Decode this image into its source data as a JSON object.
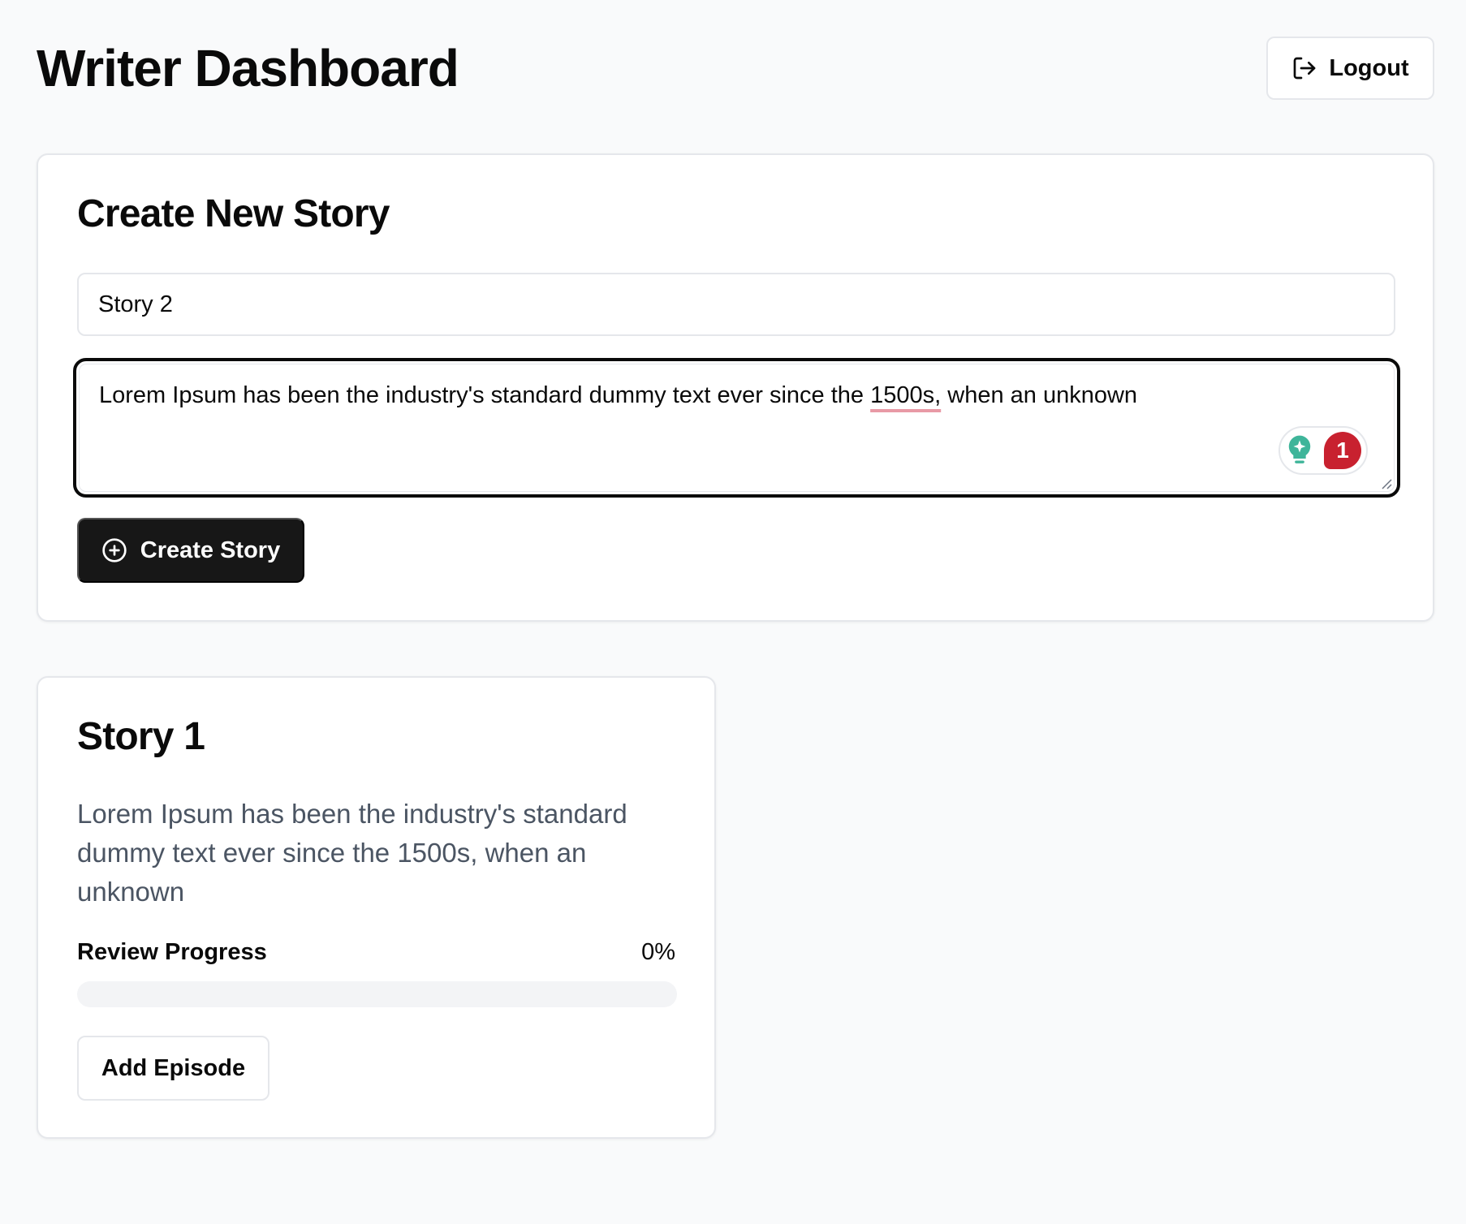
{
  "header": {
    "title": "Writer Dashboard",
    "logout_label": "Logout",
    "logout_icon": "log-out-icon"
  },
  "create_story": {
    "heading": "Create New Story",
    "title_value": "Story 2",
    "description_value_before": "Lorem Ipsum has been the industry's standard dummy text ever since the ",
    "description_flagged_word": "1500s,",
    "description_value_after": " when an unknown",
    "grammar_widget": {
      "icon": "lightbulb-icon",
      "issue_count": "1",
      "accent_color": "#3fb59a",
      "badge_color": "#c8212f"
    },
    "submit_label": "Create Story",
    "submit_icon": "plus-circle-icon"
  },
  "stories": [
    {
      "title": "Story 1",
      "description": "Lorem Ipsum has been the industry's standard dummy text ever since the 1500s, when an unknown",
      "progress_label": "Review Progress",
      "progress_text": "0%",
      "progress_fraction": 0,
      "action_label": "Add Episode"
    }
  ],
  "colors": {
    "background": "#f9fafb",
    "primary_button": "#171717",
    "muted_text": "#4b5563",
    "border": "#e5e7eb"
  }
}
